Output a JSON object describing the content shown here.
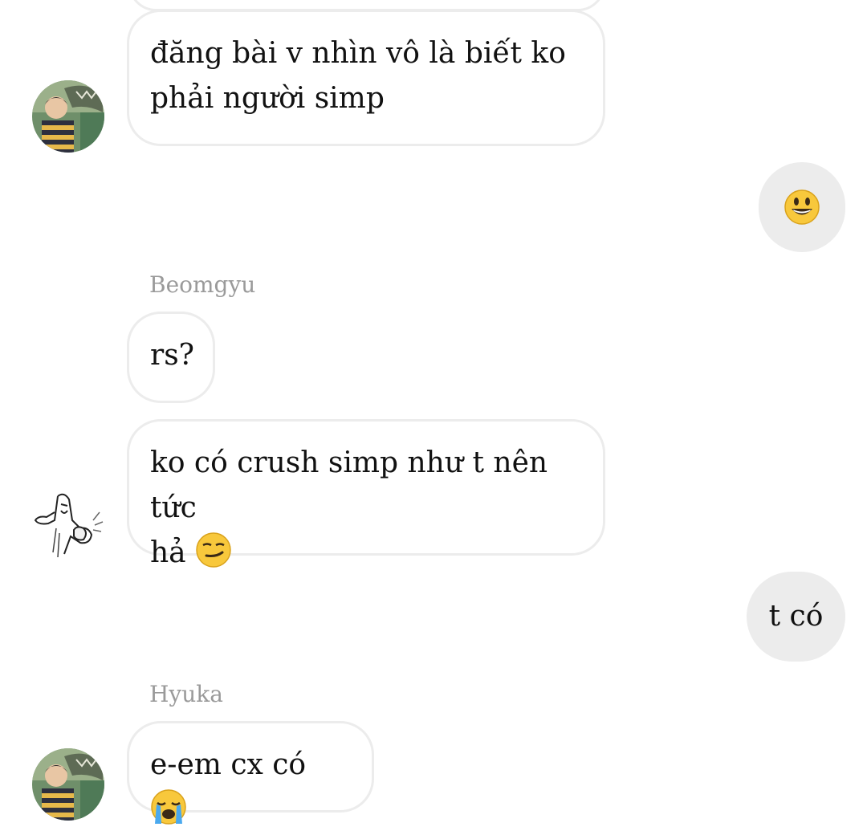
{
  "messages": [
    {
      "side": "in",
      "sender": "",
      "text": "đăng bài v nhìn vô là biết ko phải người simp",
      "line1": "đăng bài v nhìn vô là biết ko",
      "line2": "phải người simp",
      "avatar": "boy-dinosaur-avatar"
    },
    {
      "side": "out",
      "emoji": "grinning-face-emoji"
    },
    {
      "side": "in",
      "sender": "Beomgyu",
      "text": "rs?"
    },
    {
      "side": "in",
      "sender": "",
      "line1": "ko có crush simp như t nên tức",
      "line2": "hả",
      "emoji": "smirking-face-emoji",
      "avatar": "meme-sketch-avatar"
    },
    {
      "side": "out",
      "text": "t có"
    },
    {
      "side": "in",
      "sender": "Hyuka",
      "text": "e-em cx có",
      "emoji": "loudly-crying-face-emoji",
      "avatar": "boy-dinosaur-avatar"
    }
  ],
  "colors": {
    "incoming_bubble_border": "#ececec",
    "outgoing_bubble_bg": "#ececec",
    "sender_name": "#9a9a9a",
    "text": "#111111"
  }
}
